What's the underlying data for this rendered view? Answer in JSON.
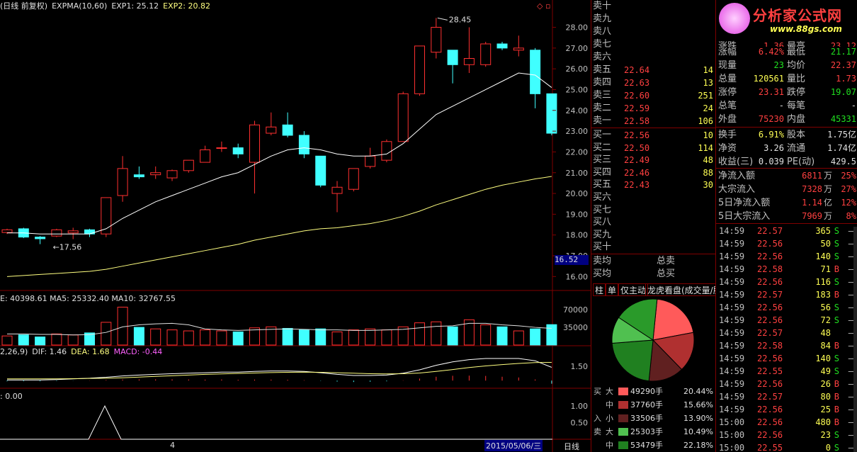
{
  "header": {
    "title_prefix": "(日线 前复权)",
    "ema_label": "EXPMA(10,60)",
    "exp1_label": "EXP1: 25.12",
    "exp2_label": "EXP2: 20.82",
    "volume_line": "E: 40398.61  MA5: 25332.40  MA10: 32767.55",
    "macd_prefix": "2,26,9)",
    "macd_dif": "DIF: 1.46",
    "macd_dea": "DEA: 1.68",
    "macd_val": "MACD: -0.44",
    "bottom_indicator": ": 0.00",
    "bottom_left_axis": "4",
    "bottom_date": "2015/05/06/三",
    "period_label": "日线"
  },
  "price_axis": {
    "ticks": [
      "28.00",
      "27.00",
      "26.00",
      "25.00",
      "24.00",
      "23.00",
      "22.00",
      "21.00",
      "20.00",
      "19.00",
      "18.00",
      "17.00",
      "16.00"
    ],
    "current_price_tag": "16.52",
    "high_annotation": "28.45",
    "low_annotation": "17.56"
  },
  "volume_axis": {
    "ticks": [
      "70000",
      "35000"
    ]
  },
  "macd_axis": {
    "ticks": [
      "1.50"
    ]
  },
  "bottom_axis": {
    "ticks": [
      "1.00",
      "0.50"
    ]
  },
  "colors": {
    "up": "#ff3030",
    "down": "#40ffff",
    "ema_short": "#ffffff",
    "ema_long": "#ffff80",
    "grid": "#800000"
  },
  "chart_data": {
    "type": "candlestick",
    "ylim": [
      15.5,
      28.7
    ],
    "candles": [
      {
        "o": 18.12,
        "h": 18.3,
        "c": 18.25,
        "l": 18.05
      },
      {
        "o": 18.3,
        "h": 18.35,
        "c": 17.9,
        "l": 17.85
      },
      {
        "o": 17.9,
        "h": 17.95,
        "c": 17.82,
        "l": 17.56
      },
      {
        "o": 17.95,
        "h": 18.3,
        "c": 18.25,
        "l": 17.9
      },
      {
        "o": 18.1,
        "h": 18.35,
        "c": 18.2,
        "l": 17.8
      },
      {
        "o": 18.25,
        "h": 18.3,
        "c": 18.05,
        "l": 17.9
      },
      {
        "o": 18.05,
        "h": 19.7,
        "c": 19.8,
        "l": 17.9
      },
      {
        "o": 19.9,
        "h": 21.8,
        "c": 21.2,
        "l": 19.6
      },
      {
        "o": 20.9,
        "h": 21.3,
        "c": 20.8,
        "l": 20.7
      },
      {
        "o": 20.9,
        "h": 21.3,
        "c": 21.0,
        "l": 20.7
      },
      {
        "o": 20.75,
        "h": 21.15,
        "c": 21.1,
        "l": 20.6
      },
      {
        "o": 21.1,
        "h": 21.6,
        "c": 21.6,
        "l": 21.0
      },
      {
        "o": 21.5,
        "h": 22.3,
        "c": 22.1,
        "l": 21.5
      },
      {
        "o": 22.2,
        "h": 22.5,
        "c": 22.2,
        "l": 22.0
      },
      {
        "o": 22.2,
        "h": 22.4,
        "c": 21.9,
        "l": 21.7
      },
      {
        "o": 21.5,
        "h": 23.5,
        "c": 23.3,
        "l": 20.0
      },
      {
        "o": 22.9,
        "h": 23.9,
        "c": 23.2,
        "l": 22.8
      },
      {
        "o": 23.3,
        "h": 23.9,
        "c": 22.8,
        "l": 22.7
      },
      {
        "o": 22.8,
        "h": 23.0,
        "c": 21.9,
        "l": 21.7
      },
      {
        "o": 21.8,
        "h": 21.8,
        "c": 20.4,
        "l": 20.3
      },
      {
        "o": 20.0,
        "h": 20.6,
        "c": 20.3,
        "l": 19.1
      },
      {
        "o": 20.2,
        "h": 21.2,
        "c": 21.2,
        "l": 20.1
      },
      {
        "o": 21.3,
        "h": 22.2,
        "c": 21.8,
        "l": 21.2
      },
      {
        "o": 21.6,
        "h": 22.6,
        "c": 22.5,
        "l": 21.5
      },
      {
        "o": 22.5,
        "h": 24.9,
        "c": 24.8,
        "l": 22.5
      },
      {
        "o": 24.8,
        "h": 27.1,
        "c": 27.1,
        "l": 24.7
      },
      {
        "o": 26.8,
        "h": 28.45,
        "c": 28.0,
        "l": 26.5
      },
      {
        "o": 26.9,
        "h": 26.9,
        "c": 26.2,
        "l": 25.3
      },
      {
        "o": 26.2,
        "h": 28.0,
        "c": 26.5,
        "l": 25.8
      },
      {
        "o": 26.2,
        "h": 27.3,
        "c": 27.2,
        "l": 26.1
      },
      {
        "o": 27.2,
        "h": 27.3,
        "c": 27.0,
        "l": 26.9
      },
      {
        "o": 26.9,
        "h": 27.6,
        "c": 27.0,
        "l": 26.6
      },
      {
        "o": 26.9,
        "h": 27.0,
        "c": 24.8,
        "l": 24.1
      },
      {
        "o": 24.8,
        "h": 24.8,
        "c": 22.9,
        "l": 22.8
      }
    ],
    "ema_short": [
      18.1,
      18.1,
      18.05,
      18.05,
      18.05,
      18.05,
      18.3,
      18.8,
      19.2,
      19.6,
      19.9,
      20.2,
      20.5,
      20.8,
      21.0,
      21.4,
      21.8,
      22.1,
      22.2,
      22.1,
      21.9,
      21.8,
      21.8,
      21.9,
      22.4,
      23.1,
      23.8,
      24.2,
      24.6,
      25.0,
      25.4,
      25.8,
      25.7,
      25.1
    ],
    "ema_long": [
      16.0,
      16.05,
      16.1,
      16.15,
      16.2,
      16.25,
      16.35,
      16.5,
      16.65,
      16.8,
      16.95,
      17.1,
      17.25,
      17.4,
      17.55,
      17.75,
      17.9,
      18.05,
      18.2,
      18.3,
      18.35,
      18.45,
      18.55,
      18.7,
      18.9,
      19.15,
      19.45,
      19.7,
      19.95,
      20.2,
      20.4,
      20.55,
      20.7,
      20.82
    ],
    "volumes": [
      18000,
      20000,
      16000,
      22000,
      20000,
      24000,
      45000,
      75000,
      35000,
      32000,
      30000,
      28000,
      30000,
      28000,
      26000,
      34000,
      36000,
      33000,
      30000,
      32000,
      26000,
      30000,
      32000,
      30000,
      36000,
      44000,
      46000,
      36000,
      50000,
      40000,
      36000,
      28000,
      32000,
      40398
    ],
    "vol_ma5": [
      22000,
      22000,
      21000,
      21000,
      20000,
      20500,
      25000,
      36000,
      40000,
      42000,
      43000,
      40000,
      32000,
      30000,
      29000,
      30000,
      31000,
      32000,
      31000,
      30000,
      30000,
      29000,
      29000,
      30000,
      31000,
      34000,
      37000,
      38000,
      43000,
      43000,
      40000,
      38000,
      35000,
      33000
    ],
    "macd_dif": [
      0.9,
      0.9,
      0.9,
      0.92,
      0.95,
      0.98,
      1.02,
      1.08,
      1.12,
      1.15,
      1.18,
      1.2,
      1.22,
      1.25,
      1.25,
      1.28,
      1.3,
      1.3,
      1.28,
      1.22,
      1.15,
      1.1,
      1.1,
      1.12,
      1.2,
      1.35,
      1.55,
      1.7,
      1.8,
      1.85,
      1.85,
      1.85,
      1.75,
      1.46
    ],
    "macd_dea": [
      0.95,
      0.95,
      0.95,
      0.95,
      0.96,
      0.97,
      0.98,
      1.0,
      1.03,
      1.06,
      1.09,
      1.12,
      1.15,
      1.17,
      1.19,
      1.21,
      1.23,
      1.24,
      1.25,
      1.24,
      1.22,
      1.2,
      1.18,
      1.17,
      1.18,
      1.21,
      1.28,
      1.36,
      1.45,
      1.52,
      1.58,
      1.63,
      1.67,
      1.68
    ]
  },
  "order_book": {
    "sell": [
      {
        "label": "卖十",
        "price": "",
        "vol": ""
      },
      {
        "label": "卖九",
        "price": "",
        "vol": ""
      },
      {
        "label": "卖八",
        "price": "",
        "vol": ""
      },
      {
        "label": "卖七",
        "price": "",
        "vol": ""
      },
      {
        "label": "卖六",
        "price": "",
        "vol": ""
      },
      {
        "label": "卖五",
        "price": "22.64",
        "vol": "14"
      },
      {
        "label": "卖四",
        "price": "22.63",
        "vol": "13"
      },
      {
        "label": "卖三",
        "price": "22.60",
        "vol": "251"
      },
      {
        "label": "卖二",
        "price": "22.59",
        "vol": "24"
      },
      {
        "label": "卖一",
        "price": "22.58",
        "vol": "106"
      }
    ],
    "buy": [
      {
        "label": "买一",
        "price": "22.56",
        "vol": "10"
      },
      {
        "label": "买二",
        "price": "22.50",
        "vol": "114"
      },
      {
        "label": "买三",
        "price": "22.49",
        "vol": "48"
      },
      {
        "label": "买四",
        "price": "22.46",
        "vol": "88"
      },
      {
        "label": "买五",
        "price": "22.43",
        "vol": "30"
      },
      {
        "label": "买六",
        "price": "",
        "vol": ""
      },
      {
        "label": "买七",
        "price": "",
        "vol": ""
      },
      {
        "label": "买八",
        "price": "",
        "vol": ""
      },
      {
        "label": "买九",
        "price": "",
        "vol": ""
      },
      {
        "label": "买十",
        "price": "",
        "vol": ""
      }
    ],
    "avg_sell_label": "卖均",
    "avg_buy_label": "买均",
    "total_sell_label": "总卖",
    "total_buy_label": "总买"
  },
  "tabs": [
    "柱",
    "单",
    "仅主动",
    "龙虎看盘(成交量/股"
  ],
  "capital": {
    "pie": [
      {
        "share": 20.44,
        "color": "#ff5a5a"
      },
      {
        "share": 15.66,
        "color": "#b03030"
      },
      {
        "share": 13.9,
        "color": "#602020"
      },
      {
        "share": 22.18,
        "color": "#208020"
      },
      {
        "share": 10.49,
        "color": "#50c050"
      },
      {
        "share": 17.33,
        "color": "#2a9a2a"
      }
    ],
    "rows": [
      {
        "side": "买",
        "size": "大",
        "color": "#ff5a5a",
        "vol": "49290手",
        "pct": "20.44%"
      },
      {
        "side": "",
        "size": "中",
        "color": "#b03030",
        "vol": "37760手",
        "pct": "15.66%"
      },
      {
        "side": "入",
        "size": "小",
        "color": "#602020",
        "vol": "33506手",
        "pct": "13.90%"
      },
      {
        "side": "卖",
        "size": "大",
        "color": "#50c050",
        "vol": "25303手",
        "pct": "10.49%"
      },
      {
        "side": "",
        "size": "中",
        "color": "#208020",
        "vol": "53479手",
        "pct": "22.18%"
      }
    ]
  },
  "logo": {
    "text": "分析家公式网",
    "url": "www.88gs.com"
  },
  "stats": {
    "top_partial": {
      "l1": "涨跌",
      "v1": "1.36",
      "l2": "最高",
      "v2": "23.12"
    },
    "rows": [
      {
        "l1": "涨幅",
        "v1": "6.42%",
        "c1": "red",
        "l2": "最低",
        "v2": "21.17",
        "c2": "green"
      },
      {
        "l1": "现量",
        "v1": "23",
        "c1": "green",
        "l2": "均价",
        "v2": "22.37",
        "c2": "red"
      },
      {
        "l1": "总量",
        "v1": "120561",
        "c1": "yellow",
        "l2": "量比",
        "v2": "1.73",
        "c2": "red"
      },
      {
        "l1": "涨停",
        "v1": "23.31",
        "c1": "red",
        "l2": "跌停",
        "v2": "19.07",
        "c2": "green"
      },
      {
        "l1": "总笔",
        "v1": "-",
        "c1": "white",
        "l2": "每笔",
        "v2": "-",
        "c2": "white"
      },
      {
        "l1": "外盘",
        "v1": "75230",
        "c1": "red",
        "l2": "内盘",
        "v2": "45331",
        "c2": "green"
      }
    ],
    "rows2": [
      {
        "l1": "换手",
        "v1": "6.91%",
        "c1": "yellow",
        "l2": "股本",
        "v2": "1.75亿",
        "c2": "white"
      },
      {
        "l1": "净资",
        "v1": "3.26",
        "c1": "white",
        "l2": "流通",
        "v2": "1.74亿",
        "c2": "white"
      },
      {
        "l1": "收益(三)",
        "v1": "0.039",
        "c1": "white",
        "l2": "PE(动)",
        "v2": "429.5",
        "c2": "white"
      }
    ],
    "flows": [
      {
        "label": "净流入额",
        "value": "6811",
        "unit": "万",
        "pct": "25%"
      },
      {
        "label": "大宗流入",
        "value": "7328",
        "unit": "万",
        "pct": "27%"
      },
      {
        "label": "5日净流入额",
        "value": "1.14",
        "unit": "亿",
        "pct": "12%"
      },
      {
        "label": "5日大宗流入",
        "value": "7969",
        "unit": "万",
        "pct": "8%"
      }
    ]
  },
  "ticks": [
    {
      "time": "14:59",
      "price": "22.57",
      "vol": "365",
      "dir": "S"
    },
    {
      "time": "14:59",
      "price": "22.56",
      "vol": "50",
      "dir": "S"
    },
    {
      "time": "14:59",
      "price": "22.56",
      "vol": "140",
      "dir": "S"
    },
    {
      "time": "14:59",
      "price": "22.58",
      "vol": "71",
      "dir": "B"
    },
    {
      "time": "14:59",
      "price": "22.56",
      "vol": "116",
      "dir": "S"
    },
    {
      "time": "14:59",
      "price": "22.57",
      "vol": "183",
      "dir": "B"
    },
    {
      "time": "14:59",
      "price": "22.56",
      "vol": "56",
      "dir": "S"
    },
    {
      "time": "14:59",
      "price": "22.56",
      "vol": "72",
      "dir": "S"
    },
    {
      "time": "14:59",
      "price": "22.57",
      "vol": "48",
      "dir": ""
    },
    {
      "time": "14:59",
      "price": "22.58",
      "vol": "84",
      "dir": "B"
    },
    {
      "time": "14:59",
      "price": "22.56",
      "vol": "140",
      "dir": "S"
    },
    {
      "time": "14:59",
      "price": "22.55",
      "vol": "49",
      "dir": "S"
    },
    {
      "time": "14:59",
      "price": "22.56",
      "vol": "26",
      "dir": "B"
    },
    {
      "time": "14:59",
      "price": "22.57",
      "vol": "80",
      "dir": "B"
    },
    {
      "time": "14:59",
      "price": "22.56",
      "vol": "25",
      "dir": "B"
    },
    {
      "time": "15:00",
      "price": "22.56",
      "vol": "480",
      "dir": "B"
    },
    {
      "time": "15:00",
      "price": "22.56",
      "vol": "23",
      "dir": "S"
    },
    {
      "time": "15:00",
      "price": "22.55",
      "vol": "0",
      "dir": "S"
    }
  ]
}
